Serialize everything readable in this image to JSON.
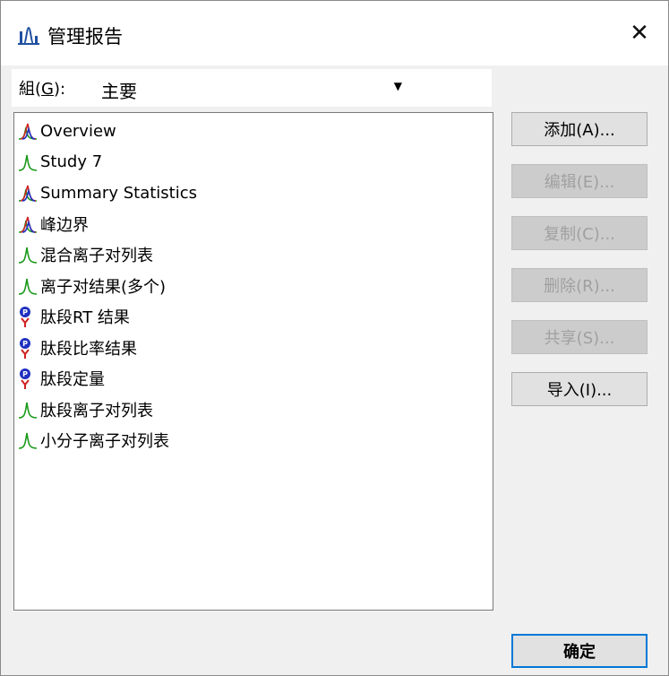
{
  "window": {
    "title": "管理报告",
    "close_symbol": "✕",
    "icon": "peak-chart-icon"
  },
  "group": {
    "label_prefix": "組(",
    "label_key": "G",
    "label_suffix": "):",
    "value": "主要",
    "arrow": "▼"
  },
  "reports": [
    {
      "label": "Overview",
      "icon": "multi-peak-icon"
    },
    {
      "label": "Study 7",
      "icon": "single-peak-icon"
    },
    {
      "label": "Summary Statistics",
      "icon": "multi-peak-icon"
    },
    {
      "label": "峰边界",
      "icon": "multi-peak-icon"
    },
    {
      "label": "混合离子对列表",
      "icon": "single-peak-icon"
    },
    {
      "label": "离子对结果(多个)",
      "icon": "single-peak-icon"
    },
    {
      "label": "肽段RT 结果",
      "icon": "peptide-icon"
    },
    {
      "label": "肽段比率结果",
      "icon": "peptide-icon"
    },
    {
      "label": "肽段定量",
      "icon": "peptide-icon"
    },
    {
      "label": "肽段离子对列表",
      "icon": "single-peak-icon"
    },
    {
      "label": "小分子离子对列表",
      "icon": "single-peak-icon"
    }
  ],
  "buttons": {
    "add": "添加(A)...",
    "edit": "编辑(E)...",
    "copy": "复制(C)...",
    "delete": "删除(R)...",
    "share": "共享(S)...",
    "import": "导入(I)...",
    "ok": "确定"
  },
  "colors": {
    "peak_green": "#1a9a1a",
    "peak_red": "#d02020",
    "peak_blue": "#2030c0",
    "title_icon_blue": "#1f4fa0",
    "focus_border": "#0078d7"
  }
}
